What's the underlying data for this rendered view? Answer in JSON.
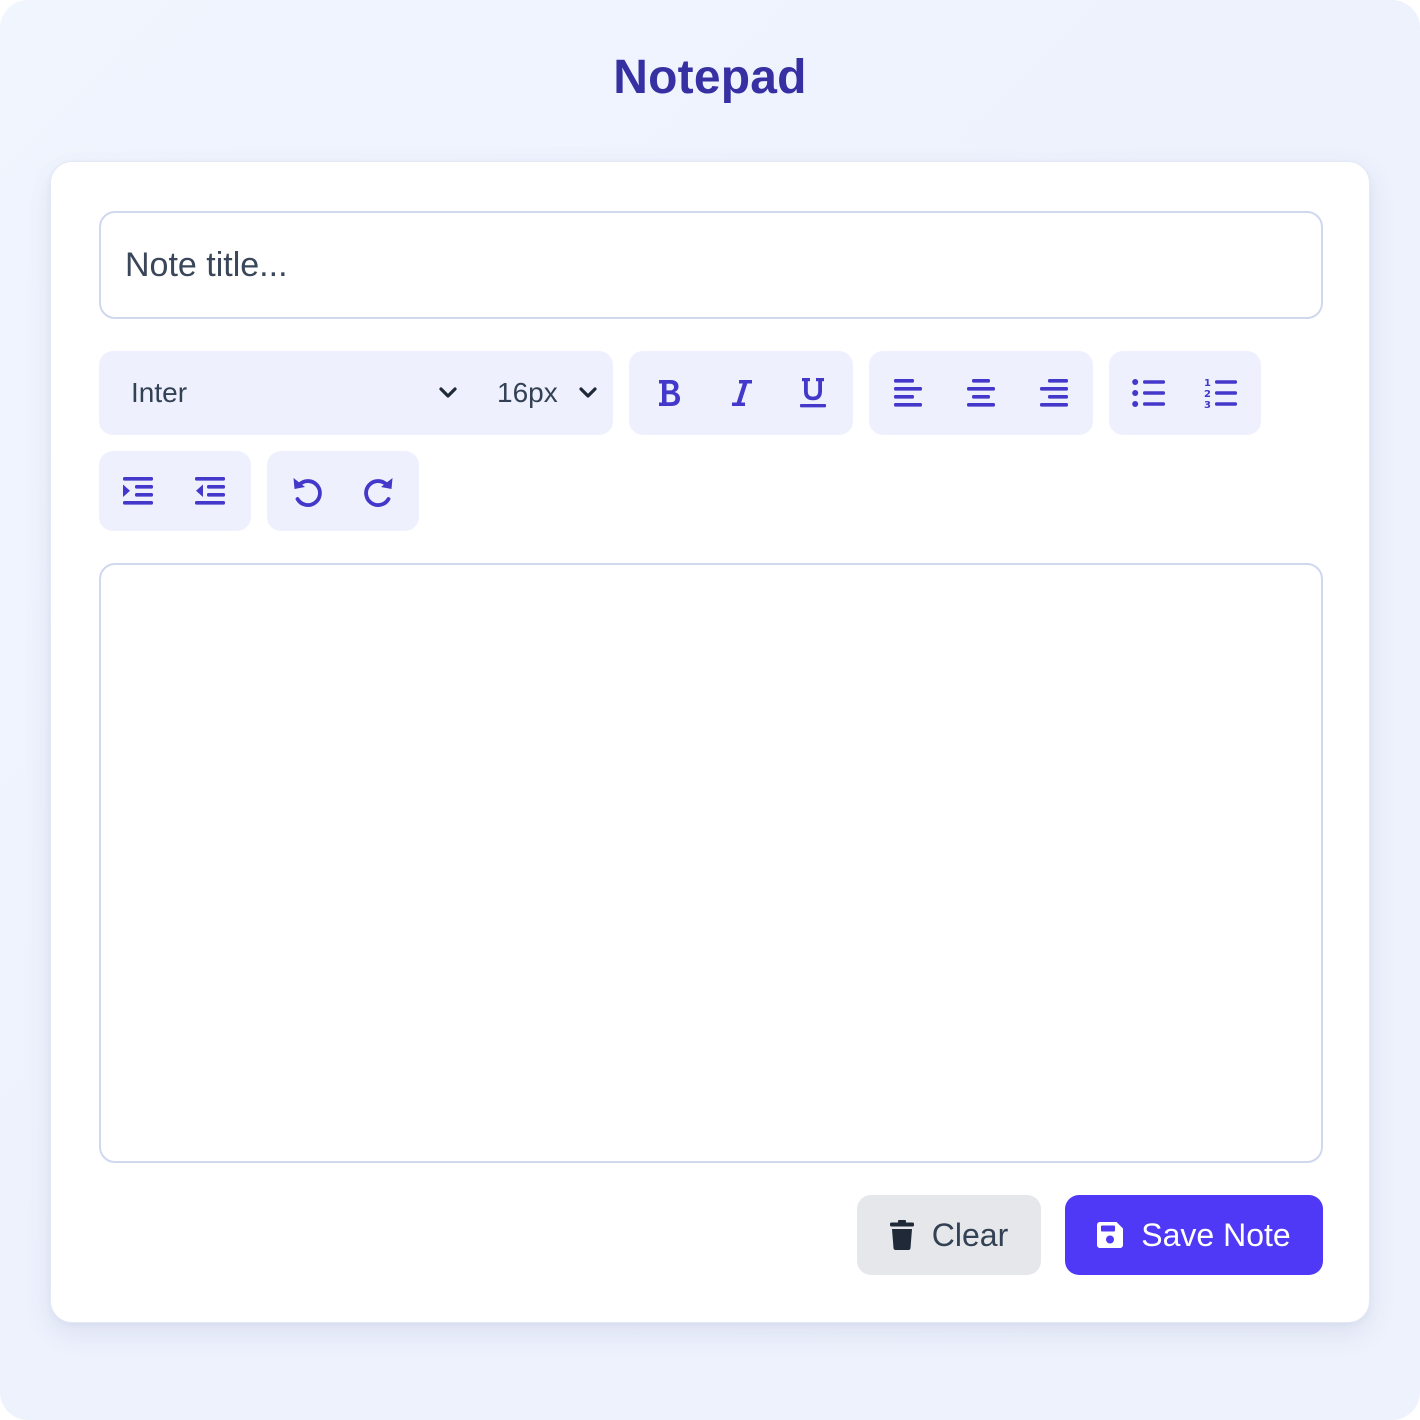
{
  "app": {
    "title": "Notepad"
  },
  "title_field": {
    "value": "",
    "placeholder": "Note title..."
  },
  "toolbar": {
    "font_family": {
      "selected": "Inter"
    },
    "font_size": {
      "selected": "16px"
    },
    "buttons": [
      "bold-icon",
      "italic-icon",
      "underline-icon",
      "align-left-icon",
      "align-center-icon",
      "align-right-icon",
      "bullet-list-icon",
      "numbered-list-icon",
      "indent-icon",
      "outdent-icon",
      "undo-icon",
      "redo-icon"
    ]
  },
  "editor": {
    "content": ""
  },
  "actions": {
    "clear_label": "Clear",
    "save_label": "Save Note"
  },
  "colors": {
    "accent": "#4f39f6",
    "title": "#3730a3",
    "icon": "#4338ca",
    "toolbar_bg": "#eef1fd"
  }
}
